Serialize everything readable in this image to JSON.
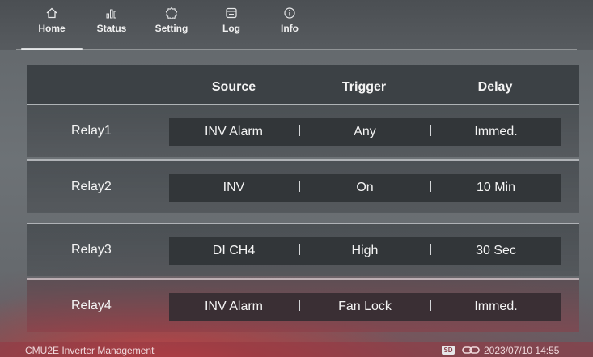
{
  "nav": {
    "tabs": [
      {
        "label": "Home",
        "icon": "home-icon"
      },
      {
        "label": "Status",
        "icon": "bar-chart-icon"
      },
      {
        "label": "Setting",
        "icon": "gear-icon"
      },
      {
        "label": "Log",
        "icon": "log-icon"
      },
      {
        "label": "Info",
        "icon": "info-icon"
      }
    ],
    "active": "Home"
  },
  "table": {
    "columns": [
      "Source",
      "Trigger",
      "Delay"
    ],
    "rows": [
      {
        "name": "Relay1",
        "source": "INV Alarm",
        "trigger": "Any",
        "delay": "Immed."
      },
      {
        "name": "Relay2",
        "source": "INV",
        "trigger": "On",
        "delay": "10 Min"
      },
      {
        "name": "Relay3",
        "source": "DI CH4",
        "trigger": "High",
        "delay": "30 Sec"
      },
      {
        "name": "Relay4",
        "source": "INV Alarm",
        "trigger": "Fan Lock",
        "delay": "Immed."
      }
    ]
  },
  "footer": {
    "title": "CMU2E Inverter Management",
    "sd_label": "SD",
    "link_icon": "link-icon",
    "datetime": "2023/07/10 14:55"
  },
  "colors": {
    "panel_header": "#3c4145",
    "cell_bg": "#323639",
    "footer_tint": "#963741"
  }
}
